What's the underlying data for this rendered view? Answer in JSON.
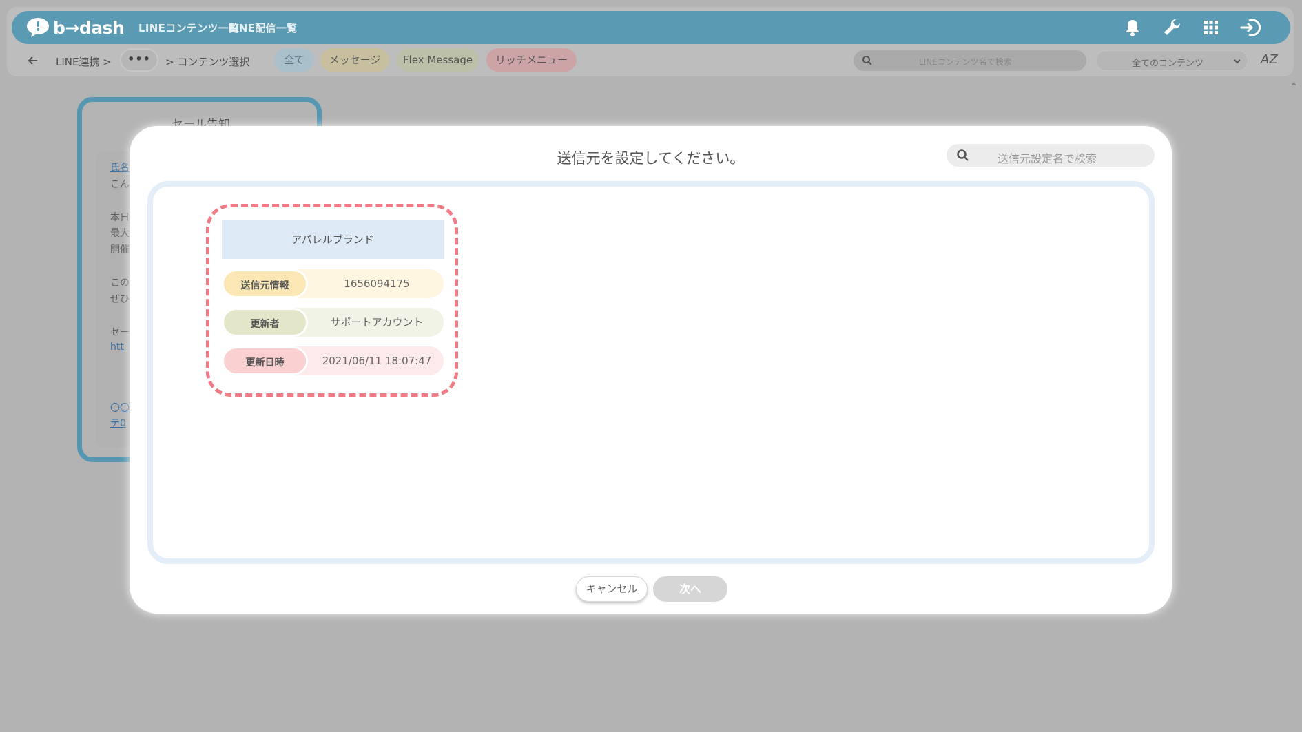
{
  "app": {
    "brand": "b→dash"
  },
  "nav": {
    "links": [
      "LINEコンテンツ一覧",
      "LINE配信一覧"
    ]
  },
  "subbar": {
    "crumb_root": "LINE連携 >",
    "crumb_dots": "•••",
    "crumb_current": "> コンテンツ選択",
    "tabs": [
      "全て",
      "メッセージ",
      "Flex Message",
      "リッチメニュー"
    ],
    "search_placeholder": "LINEコンテンツ名で検索",
    "filter_value": "全てのコンテンツ",
    "sort_label": "AZ"
  },
  "background_card": {
    "title": "セール告知",
    "lines": [
      "氏名",
      "こん",
      "本日",
      "最大",
      "開催",
      "この",
      "ぜひ",
      "セー",
      "htt",
      "〇〇",
      "テ0"
    ]
  },
  "modal": {
    "title": "送信元を設定してください。",
    "search_placeholder": "送信元設定名で検索",
    "sender": {
      "name": "アパレルブランド",
      "rows": [
        {
          "label": "送信元情報",
          "value": "1656094175"
        },
        {
          "label": "更新者",
          "value": "サポートアカウント"
        },
        {
          "label": "更新日時",
          "value": "2021/06/11 18:07:47"
        }
      ]
    },
    "cancel_label": "キャンセル",
    "next_label": "次へ"
  },
  "colors": {
    "nav_bg": "#5a9ab2",
    "selection_border": "#f07a86",
    "sender_head_bg": "#dde9f4",
    "row1_bg": "#fff6e2",
    "row2_bg": "#eef0e2",
    "row3_bg": "#fde6e6"
  }
}
